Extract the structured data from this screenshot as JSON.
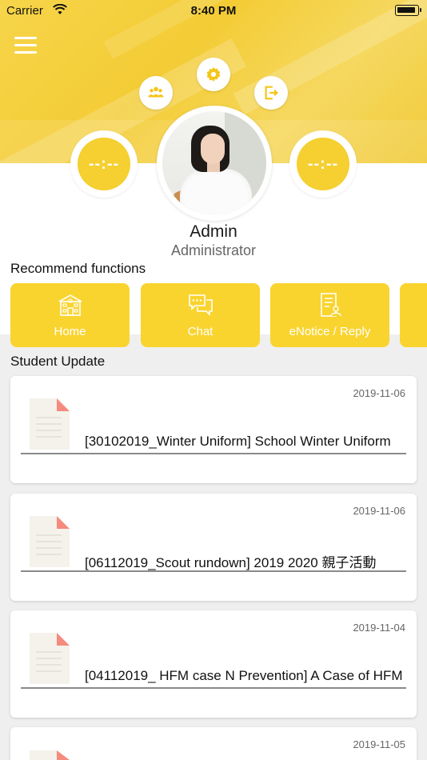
{
  "status_bar": {
    "carrier": "Carrier",
    "time": "8:40 PM"
  },
  "header": {
    "left_counter": "--:--",
    "right_counter": "--:--"
  },
  "user": {
    "name": "Admin",
    "role": "Administrator"
  },
  "recommend": {
    "title": "Recommend functions",
    "tiles": [
      {
        "label": "Home",
        "icon": "school-building-icon"
      },
      {
        "label": "Chat",
        "icon": "chat-bubbles-icon"
      },
      {
        "label": "eNotice / Reply",
        "icon": "notice-document-icon"
      },
      {
        "label": "",
        "icon": ""
      }
    ]
  },
  "updates": {
    "title": "Student Update",
    "items": [
      {
        "date": "2019-11-06",
        "title": "[30102019_Winter  Uniform] School Winter Uniform"
      },
      {
        "date": "2019-11-06",
        "title": "[06112019_Scout rundown] 2019 2020 親子活動"
      },
      {
        "date": "2019-11-04",
        "title": "[04112019_ HFM case N Prevention] A Case of HFM"
      },
      {
        "date": "2019-11-05",
        "title": ""
      }
    ]
  },
  "colors": {
    "accent": "#f9d42f",
    "banner": "#f5d140"
  }
}
